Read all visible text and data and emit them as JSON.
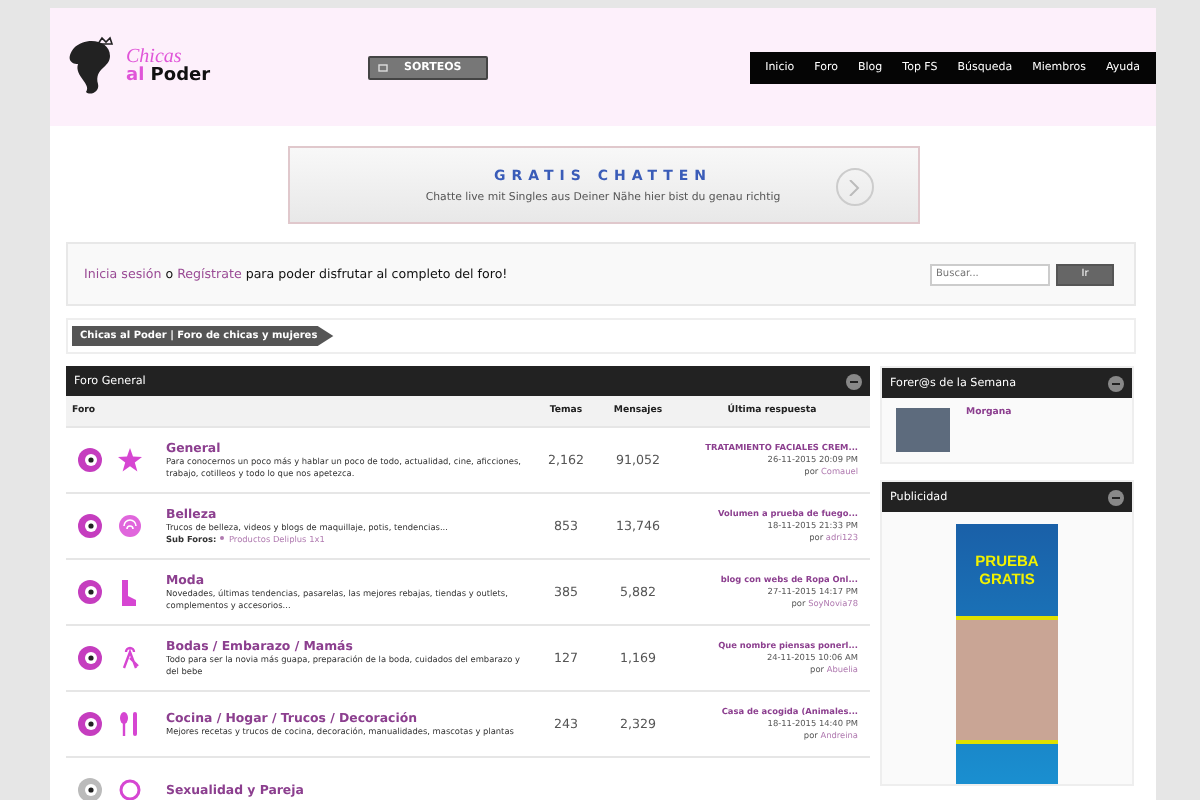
{
  "header": {
    "logo": {
      "line1": "Chicas",
      "line2_a": "al",
      "line2_b": "Poder"
    },
    "sorteos": "SORTEOS",
    "nav": [
      {
        "label": "Inicio"
      },
      {
        "label": "Foro"
      },
      {
        "label": "Blog"
      },
      {
        "label": "Top FS"
      },
      {
        "label": "Búsqueda"
      },
      {
        "label": "Miembros"
      },
      {
        "label": "Ayuda"
      }
    ]
  },
  "top_ad": {
    "title": "GRATIS CHATTEN",
    "text": "Chatte live mit Singles aus Deiner Nähe hier bist du genau richtig"
  },
  "login_bar": {
    "login": "Inicia sesión",
    "or": "o",
    "register": "Regístrate",
    "rest": "para poder disfrutar al completo del foro!",
    "search_placeholder": "Buscar...",
    "search_button": "Ir"
  },
  "breadcrumb": "Chicas al Poder | Foro de chicas y mujeres",
  "forum": {
    "title": "Foro General",
    "columns": [
      "Foro",
      "Temas",
      "Mensajes",
      "Última respuesta"
    ],
    "rows": [
      {
        "kind": "star",
        "unread": true,
        "name": "General",
        "description": "Para conocernos un poco más y hablar un poco de todo, actualidad, cine, aficciones, trabajo, cotilleos y todo lo que nos apetezca.",
        "topics": "2,162",
        "posts": "91,052",
        "last_title": "TRATAMIENTO FACIALES CREM...",
        "last_date": "26-11-2015 20:09 PM",
        "last_by_label": "por",
        "last_by": "Comauel"
      },
      {
        "kind": "rose",
        "unread": true,
        "name": "Belleza",
        "description": "Trucos de belleza, videos y blogs de maquillaje, potis, tendencias...",
        "subforums_label": "Sub Foros:",
        "subforums": [
          "Productos Deliplus 1x1"
        ],
        "topics": "853",
        "posts": "13,746",
        "last_title": "Volumen a prueba de fuego...",
        "last_date": "18-11-2015 21:33 PM",
        "last_by_label": "por",
        "last_by": "adri123"
      },
      {
        "kind": "boot",
        "unread": true,
        "name": "Moda",
        "description": "Novedades, últimas tendencias, pasarelas, las mejores rebajas, tiendas y outlets, complementos y accesorios...",
        "topics": "385",
        "posts": "5,882",
        "last_title": "blog con webs de Ropa Onl...",
        "last_date": "27-11-2015 14:17 PM",
        "last_by_label": "por",
        "last_by": "SoyNovia78"
      },
      {
        "kind": "bride",
        "unread": true,
        "name": "Bodas / Embarazo / Mamás",
        "description": "Todo para ser la novia más guapa, preparación de la boda, cuidados del embarazo y del bebe",
        "topics": "127",
        "posts": "1,169",
        "last_title": "Que nombre piensas ponerl...",
        "last_date": "24-11-2015 10:06 AM",
        "last_by_label": "por",
        "last_by": "Abuelia"
      },
      {
        "kind": "utensils",
        "unread": true,
        "name": "Cocina / Hogar / Trucos / Decoración",
        "description": "Mejores recetas y trucos de cocina, decoración, manualidades, mascotas y plantas",
        "topics": "243",
        "posts": "2,329",
        "last_title": "Casa de acogida (Animales...",
        "last_date": "18-11-2015 14:40 PM",
        "last_by_label": "por",
        "last_by": "Andreina"
      },
      {
        "kind": "circle",
        "unread": false,
        "name": "Sexualidad y Pareja"
      }
    ]
  },
  "side_panels": [
    {
      "kind": "member",
      "title": "Forer@s de la Semana",
      "member": "Morgana"
    },
    {
      "kind": "ad",
      "title": "Publicidad",
      "ad_text": "PRUEBA GRATIS"
    }
  ]
}
